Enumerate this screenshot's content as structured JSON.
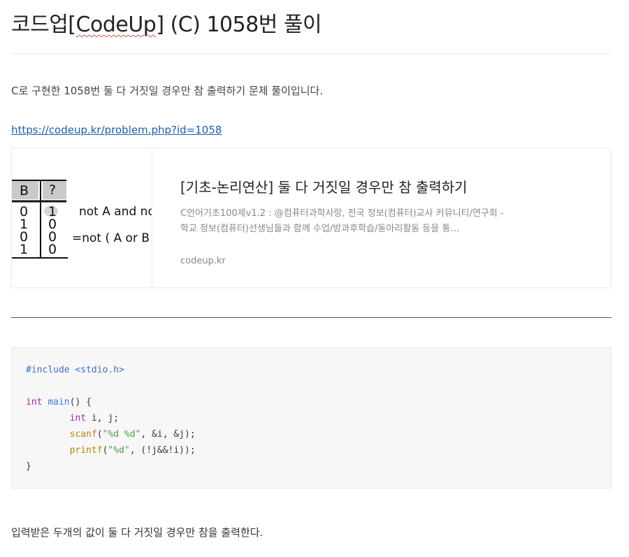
{
  "post": {
    "title_prefix": "코드업[",
    "title_spell": "CodeUp",
    "title_suffix": "] (C) 1058번 풀이",
    "intro": "C로 구현한 1058번 둘 다 거짓일 경우만 참 출력하기 문제 풀이입니다.",
    "link_text": "https://codeup.kr/problem.php?id=1058",
    "outro": "입력받은 두개의 값이 둘 다 거짓일 경우만 참을 출력한다."
  },
  "og_card": {
    "title": "[기초-논리연산] 둘 다 거짓일 경우만 참 출력하기",
    "description": "C언어기초100제v1.2 : @컴퓨터과학사랑, 전국 정보(컴퓨터)교사 커뮤니티/연구회 - 학교 정보(컴퓨터)선생님들과 함께 수업/방과후학습/동아리활동 등을 통…",
    "host": "codeup.kr",
    "thumbnail": {
      "header": [
        "B",
        "?"
      ],
      "rows": [
        [
          "0",
          "1"
        ],
        [
          "1",
          "0"
        ],
        [
          "0",
          "0"
        ],
        [
          "1",
          "0"
        ]
      ],
      "text_line1": "not A and no",
      "text_line2": "=not ( A or B"
    }
  },
  "code": {
    "line1_pre": "#include <stdio.h>",
    "kw_int": "int",
    "fn_main": "main",
    "main_parens": "() {",
    "decl_rest": " i, j;",
    "scanf_fn": "scanf",
    "scanf_open": "(",
    "scanf_str": "\"%d %d\"",
    "scanf_args": ", &i, &j);",
    "printf_fn": "printf",
    "printf_open": "(",
    "printf_str": "\"%d\"",
    "printf_args": ", (!j&&!i));",
    "close_brace": "}"
  },
  "colors": {
    "link": "#1a5fb4",
    "code_bg": "#f7f7f7",
    "keyword": "#a626a4",
    "string": "#50a14f",
    "preprocessor": "#3e6fc9"
  }
}
